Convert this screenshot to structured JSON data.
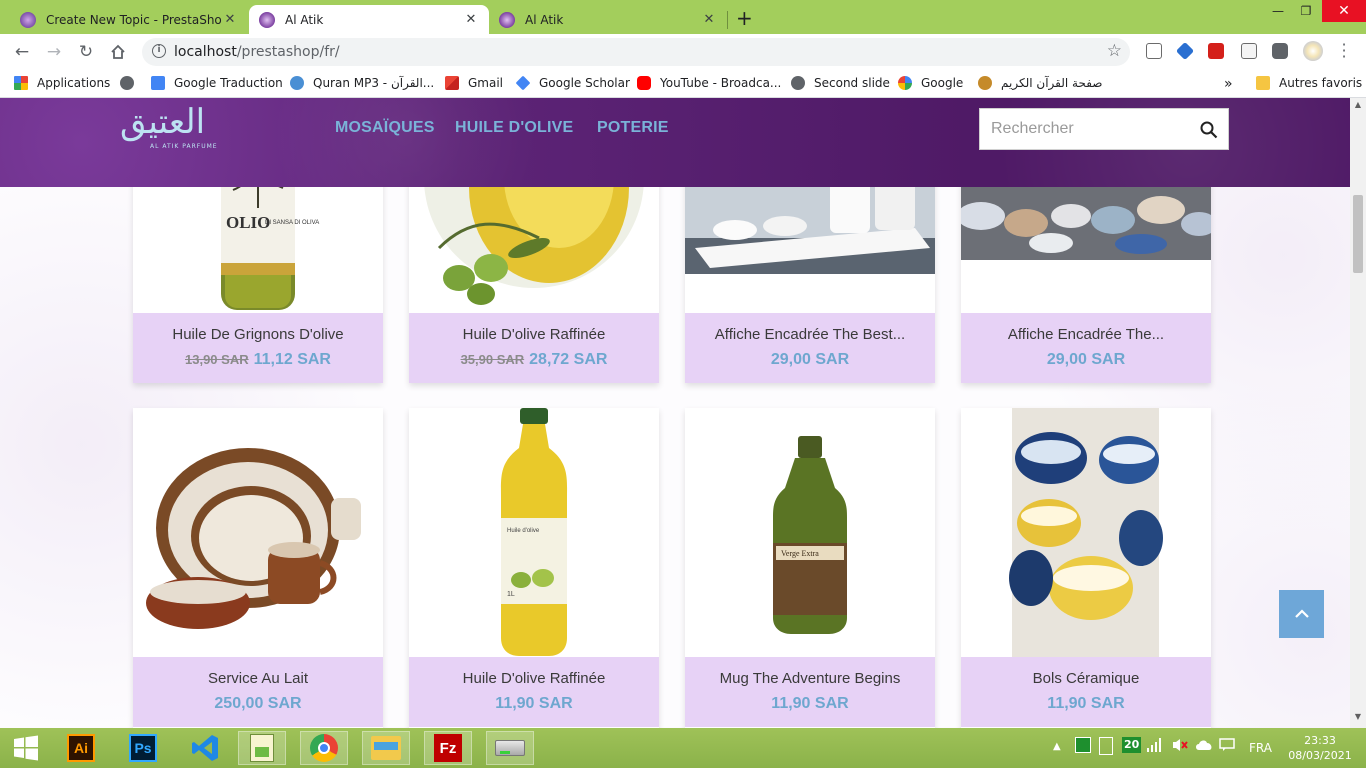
{
  "browser": {
    "tabs": [
      {
        "title": "Create New Topic - PrestaShop F",
        "active": false,
        "favicon_color": "#7b4fa8"
      },
      {
        "title": "Al Atik",
        "active": true,
        "favicon_color": "#7b3fa0"
      },
      {
        "title": "Al Atik",
        "active": false,
        "favicon_color": "#7b3fa0"
      }
    ],
    "url_host": "localhost",
    "url_path": "/prestashop/fr/",
    "bookmarks": [
      {
        "label": "Applications",
        "icon": "apps-grid-icon"
      },
      {
        "label": "",
        "icon": "globe-icon"
      },
      {
        "label": "Google Traduction",
        "icon": "translate-icon"
      },
      {
        "label": "Quran MP3 - القرآن...",
        "icon": "quran-icon"
      },
      {
        "label": "Gmail",
        "icon": "gmail-icon"
      },
      {
        "label": "Google Scholar",
        "icon": "scholar-icon"
      },
      {
        "label": "YouTube - Broadca...",
        "icon": "youtube-icon"
      },
      {
        "label": "Second slide",
        "icon": "globe-icon"
      },
      {
        "label": "Google",
        "icon": "google-icon"
      },
      {
        "label": "صفحة القرآن الكريم",
        "icon": "quran-page-icon"
      }
    ],
    "bookmarks_overflow": "»",
    "other_bookmarks": "Autres favoris"
  },
  "site": {
    "logo_arabic": "العتيق",
    "logo_subtitle": "AL ATIK PARFUME",
    "menu": [
      "MOSAÏQUES",
      "HUILE D'OLIVE",
      "POTERIE"
    ],
    "search_placeholder": "Rechercher",
    "accent": "#6ea7cf",
    "header_color": "#561c70",
    "card_info_bg": "#e7d2f6"
  },
  "products_row1": [
    {
      "name": "Huile De Grignons D'olive",
      "old_price": "13,90 SAR",
      "price": "11,12 SAR"
    },
    {
      "name": "Huile D'olive Raffinée",
      "old_price": "35,90 SAR",
      "price": "28,72 SAR"
    },
    {
      "name": "Affiche Encadrée The Best...",
      "old_price": "",
      "price": "29,00 SAR"
    },
    {
      "name": "Affiche Encadrée The...",
      "old_price": "",
      "price": "29,00 SAR"
    }
  ],
  "products_row2": [
    {
      "name": "Service Au Lait",
      "price": "250,00 SAR"
    },
    {
      "name": "Huile D'olive Raffinée",
      "price": "11,90 SAR"
    },
    {
      "name": "Mug The Adventure Begins",
      "price": "11,90 SAR"
    },
    {
      "name": "Bols Céramique",
      "price": "11,90 SAR"
    }
  ],
  "product_image_texts": {
    "olive_bottle_label": "OLIO",
    "olive_bottle_sub": "DI SANSA DI OLIVA",
    "oil_bottle_label": "Huile d'olive",
    "oil_bottle_volume": "1L",
    "green_bottle_label": "Verge Extra"
  },
  "taskbar": {
    "apps": [
      {
        "name": "illustrator",
        "text": "Ai"
      },
      {
        "name": "photoshop",
        "text": "Ps"
      },
      {
        "name": "vscode",
        "text": ""
      },
      {
        "name": "notepad-plus",
        "text": ""
      },
      {
        "name": "chrome",
        "text": ""
      },
      {
        "name": "file-explorer",
        "text": ""
      },
      {
        "name": "filezilla",
        "text": "Fz"
      },
      {
        "name": "drive",
        "text": ""
      }
    ],
    "tray_badge": "20",
    "language": "FRA",
    "time": "23:33",
    "date": "08/03/2021"
  }
}
